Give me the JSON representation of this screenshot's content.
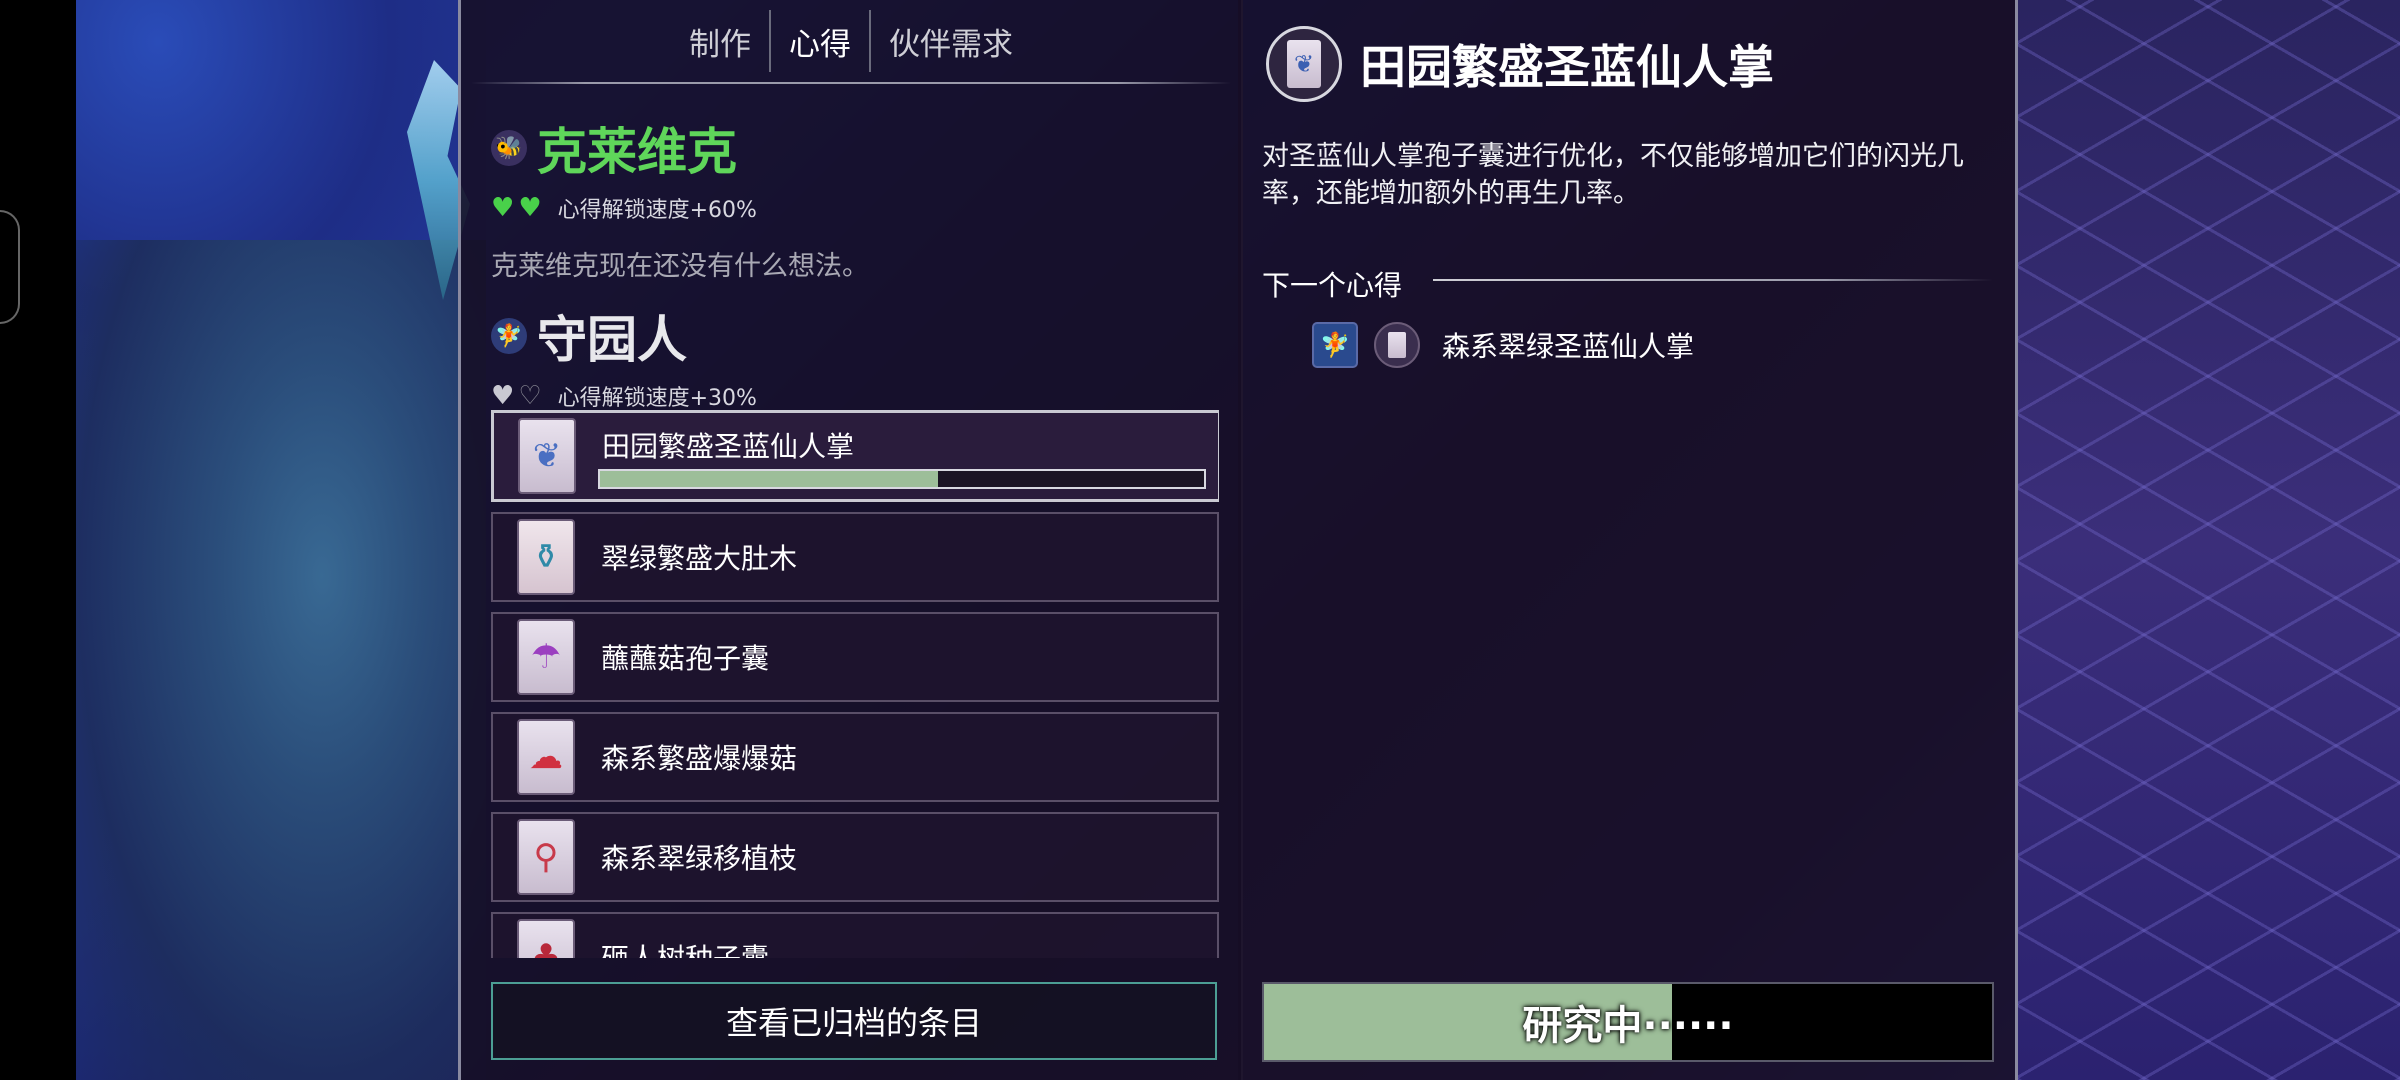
{
  "tabs": [
    {
      "label": "制作"
    },
    {
      "label": "心得"
    },
    {
      "label": "伙伴需求"
    }
  ],
  "npcs": [
    {
      "name": "克莱维克",
      "hearts_filled": 2,
      "hearts_total": 2,
      "bonus": "心得解锁速度+60%",
      "thought": "克莱维克现在还没有什么想法。"
    },
    {
      "name": "守园人",
      "hearts_filled": 1,
      "hearts_total": 2,
      "bonus": "心得解锁速度+30%"
    }
  ],
  "recipes": [
    {
      "name": "田园繁盛圣蓝仙人掌",
      "icon": "blue-cactus-pack-icon",
      "selected": true,
      "progress": 0.56
    },
    {
      "name": "翠绿繁盛大肚木",
      "icon": "green-bottle-tree-pack-icon",
      "selected": false
    },
    {
      "name": "蘸蘸菇孢子囊",
      "icon": "purple-mushroom-pack-icon",
      "selected": false
    },
    {
      "name": "森系繁盛爆爆菇",
      "icon": "red-mushroom-pack-icon",
      "selected": false
    },
    {
      "name": "森系翠绿移植枝",
      "icon": "red-sapling-pack-icon",
      "selected": false
    },
    {
      "name": "砸人树种子囊",
      "icon": "red-tree-pack-icon",
      "selected": false
    }
  ],
  "archive_button": {
    "label": "查看已归档的条目"
  },
  "detail": {
    "title": "田园繁盛圣蓝仙人掌",
    "description": "对圣蓝仙人掌孢子囊进行优化，不仅能够增加它们的闪光几率，还能增加额外的再生几率。",
    "next_label": "下一个心得",
    "next_item": "森系翠绿圣蓝仙人掌"
  },
  "research": {
    "label": "研究中······",
    "progress": 0.56
  },
  "colors": {
    "accent_green": "#5fd65a",
    "progress_green": "#9dbe99",
    "panel_bg": "#160e24"
  }
}
